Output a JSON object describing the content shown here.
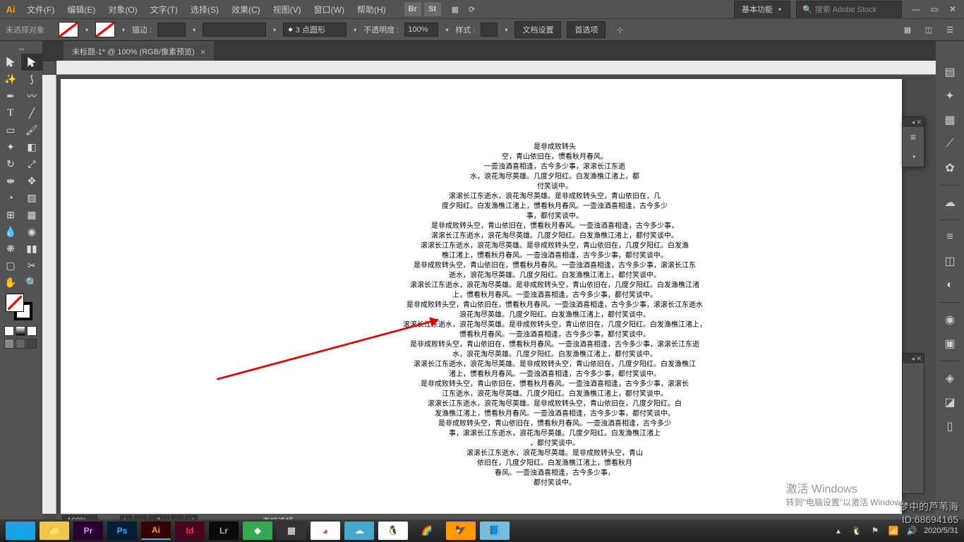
{
  "app": {
    "logo": "Ai"
  },
  "menu": [
    "文件(F)",
    "编辑(E)",
    "对象(O)",
    "文字(T)",
    "选择(S)",
    "效果(C)",
    "视图(V)",
    "窗口(W)",
    "帮助(H)"
  ],
  "titlebar_icons": [
    "Br",
    "St"
  ],
  "workspace": "基本功能",
  "search_placeholder": "搜索 Adobe Stock",
  "control": {
    "no_selection": "未选择对象",
    "stroke_label": "描边 :",
    "stroke_value": "",
    "brush_value": "3 点圆形",
    "opacity_label": "不透明度 :",
    "opacity_value": "100%",
    "style_label": "样式 :",
    "doc_setup": "文档设置",
    "prefs": "首选项"
  },
  "doc_tab": "未标题-1* @ 100% (RGB/像素预览)",
  "heart_lines": [
    "是非成败转头",
    "空，青山依旧在，惯看秋月春风。",
    "一壶浊酒喜相逢，古今多少事，滚滚长江东逝",
    "水，浪花淘尽英雄。几度夕阳红。白发渔樵江渚上，都",
    "付笑谈中。",
    "滚滚长江东逝水，浪花淘尽英雄。是非成败转头空，青山依旧在，几",
    "度夕阳红。白发渔樵江渚上，惯看秋月春风。一壶浊酒喜相逢，古今多少",
    "事，都付笑谈中。",
    "是非成败转头空，青山依旧在，惯看秋月春风。一壶浊酒喜相逢，古今多少事，",
    "滚滚长江东逝水，浪花淘尽英雄。几度夕阳红。白发渔樵江渚上，都付笑谈中。",
    "滚滚长江东逝水，浪花淘尽英雄。是非成败转头空，青山依旧在，几度夕阳红。白发渔",
    "樵江渚上，惯看秋月春风。一壶浊酒喜相逢，古今多少事，都付笑谈中。",
    "是非成败转头空，青山依旧在，惯看秋月春风。一壶浊酒喜相逢，古今多少事，滚滚长江东",
    "逝水，浪花淘尽英雄。几度夕阳红。白发渔樵江渚上，都付笑谈中。",
    "滚滚长江东逝水，浪花淘尽英雄。是非成败转头空，青山依旧在，几度夕阳红。白发渔樵江渚",
    "上，惯看秋月春风。一壶浊酒喜相逢，古今多少事，都付笑谈中。",
    "是非成败转头空，青山依旧在，惯看秋月春风。一壶浊酒喜相逢，古今多少事，滚滚长江东逝水",
    "浪花淘尽英雄。几度夕阳红。白发渔樵江渚上，都付笑谈中。",
    "滚滚长江东逝水，浪花淘尽英雄。是非成败转头空，青山依旧在，几度夕阳红。白发渔樵江渚上，",
    "惯看秋月春风。一壶浊酒喜相逢，古今多少事，都付笑谈中。",
    "是非成败转头空，青山依旧在，惯看秋月春风。一壶浊酒喜相逢，古今多少事，滚滚长江东逝",
    "水，浪花淘尽英雄。几度夕阳红。白发渔樵江渚上，都付笑谈中。",
    "滚滚长江东逝水，浪花淘尽英雄。是非成败转头空，青山依旧在，几度夕阳红。白发渔樵江",
    "渚上，惯看秋月春风。一壶浊酒喜相逢，古今多少事，都付笑谈中。",
    "是非成败转头空，青山依旧在，惯看秋月春风。一壶浊酒喜相逢，古今多少事，滚滚长",
    "江东逝水，浪花淘尽英雄。几度夕阳红。白发渔樵江渚上，都付笑谈中。",
    "滚滚长江东逝水，浪花淘尽英雄。是非成败转头空，青山依旧在，几度夕阳红。白",
    "发渔樵江渚上，惯看秋月春风。一壶浊酒喜相逢，古今多少事，都付笑谈中。",
    "是非成败转头空，青山依旧在，惯看秋月春风。一壶浊酒喜相逢，古今多少",
    "事，滚滚长江东逝水，浪花淘尽英雄。几度夕阳红。白发渔樵江渚上",
    "，都付笑谈中。",
    "滚滚长江东逝水，浪花淘尽英雄。是非成败转头空，青山",
    "依旧在，几度夕阳红。白发渔樵江渚上，惯看秋月",
    "春风。一壶浊酒喜相逢，古今多少事，",
    "都付笑谈中。"
  ],
  "status": {
    "zoom": "100%",
    "page": "1",
    "tool": "直接选择"
  },
  "activate": {
    "title": "激活 Windows",
    "desc": "转到\"电脑设置\"以激活 Windows。"
  },
  "watermark": {
    "l1": "梦中的芦苇海",
    "l2": "ID:68694165"
  },
  "tray": {
    "date": "2020/5/31"
  }
}
